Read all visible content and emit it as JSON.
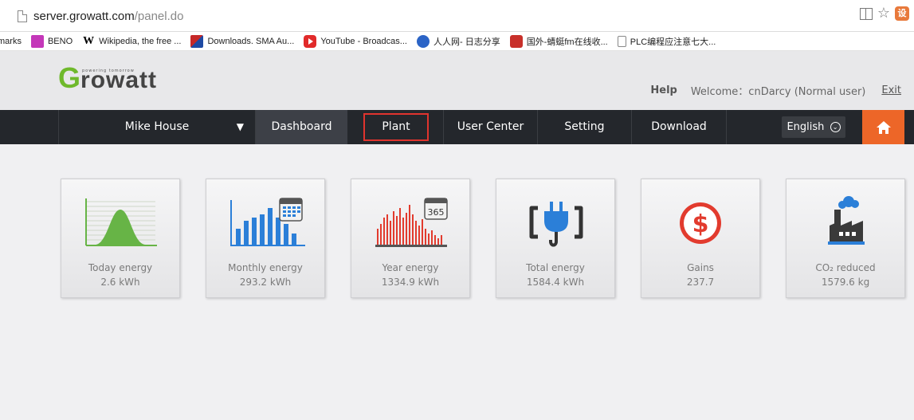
{
  "browser": {
    "url_host": "server.growatt.com",
    "url_path": "/panel.do",
    "bookmarks": [
      {
        "label": "marks",
        "icon": "none"
      },
      {
        "label": "BENO",
        "icon": "beno-icon"
      },
      {
        "label": "Wikipedia, the free ...",
        "icon": "wikipedia-icon"
      },
      {
        "label": "Downloads. SMA Au...",
        "icon": "sma-icon"
      },
      {
        "label": "YouTube - Broadcas...",
        "icon": "youtube-icon"
      },
      {
        "label": "人人网- 日志分享",
        "icon": "renren-icon"
      },
      {
        "label": "国外-蜻蜓fm在线收...",
        "icon": "qingting-icon"
      },
      {
        "label": "PLC编程应注意七大...",
        "icon": "document-icon"
      }
    ],
    "ext_icon_char": "设"
  },
  "header": {
    "logo_tagline": "powering tomorrow",
    "logo_first": "G",
    "logo_rest": "rowatt",
    "help": "Help",
    "welcome": "Welcome：cnDarcy (Normal user)",
    "exit": "Exit"
  },
  "nav": {
    "plant_select": "Mike House",
    "plant_arrow": "▼",
    "items": [
      "Dashboard",
      "Plant",
      "User Center",
      "Setting",
      "Download"
    ],
    "language": "English",
    "language_icon": "⌄"
  },
  "cards": [
    {
      "label": "Today energy",
      "value": "2.6 kWh",
      "icon": "bell-curve-chart-icon"
    },
    {
      "label": "Monthly energy",
      "value": "293.2 kWh",
      "icon": "monthly-bar-calendar-icon"
    },
    {
      "label": "Year energy",
      "value": "1334.9 kWh",
      "icon": "year-bar-calendar-icon"
    },
    {
      "label": "Total energy",
      "value": "1584.4 kWh",
      "icon": "plug-icon"
    },
    {
      "label": "Gains",
      "value": "237.7",
      "icon": "dollar-icon"
    },
    {
      "label": "CO₂ reduced",
      "value": "1579.6 kg",
      "icon": "factory-icon"
    }
  ],
  "icon_text": {
    "calendar_365": "365"
  },
  "colors": {
    "nav_bg": "#24272c",
    "accent_orange": "#ed6628",
    "highlight_red": "#e0342e",
    "logo_green": "#6fb92c",
    "blue": "#2b7fd8",
    "red": "#e23b2e"
  }
}
